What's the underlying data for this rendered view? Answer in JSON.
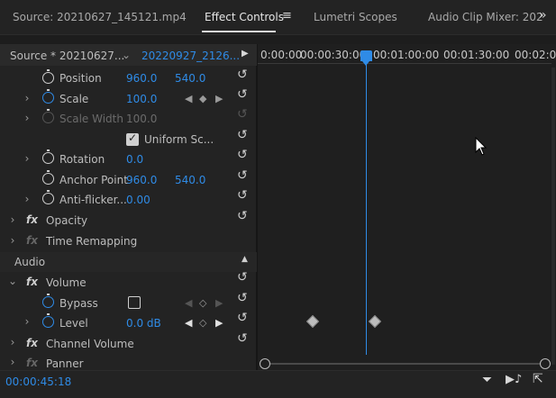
{
  "tabs": {
    "source": "Source: 20210627_145121.mp4",
    "effect_controls": "Effect Controls",
    "lumetri": "Lumetri Scopes",
    "audio_mixer": "Audio Clip Mixer: 202"
  },
  "header": {
    "source_clip": "Source * 20210627...",
    "sequence_clip": "20220927_2126..."
  },
  "ruler": [
    "0:00:00",
    "00:00:30:00",
    "00:01:00:00",
    "00:01:30:00",
    "00:02:0"
  ],
  "rows": {
    "position": {
      "label": "Position",
      "x": "960.0",
      "y": "540.0"
    },
    "scale": {
      "label": "Scale",
      "value": "100.0"
    },
    "scale_width": {
      "label": "Scale Width",
      "value": "100.0"
    },
    "uniform": {
      "label": "Uniform Sc..."
    },
    "rotation": {
      "label": "Rotation",
      "value": "0.0"
    },
    "anchor": {
      "label": "Anchor Point",
      "x": "960.0",
      "y": "540.0"
    },
    "antiflicker": {
      "label": "Anti-flicker...",
      "value": "0.00"
    },
    "opacity": {
      "label": "Opacity"
    },
    "time_remap": {
      "label": "Time Remapping"
    },
    "audio": {
      "label": "Audio"
    },
    "volume": {
      "label": "Volume"
    },
    "bypass": {
      "label": "Bypass"
    },
    "level": {
      "label": "Level",
      "value": "0.0 dB"
    },
    "channel_volume": {
      "label": "Channel Volume"
    },
    "panner": {
      "label": "Panner"
    }
  },
  "footer": {
    "timecode": "00:00:45:18"
  },
  "colors": {
    "accent": "#2f8be6",
    "panel": "#232323",
    "background": "#1d1d1d"
  }
}
